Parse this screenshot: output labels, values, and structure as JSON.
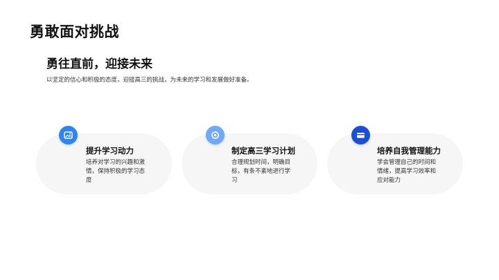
{
  "slide": {
    "title": "勇敢面对挑战",
    "subtitle": "勇往直前，迎接未来",
    "intro": "以坚定的信心和积极的态度，迎接高三的挑战，为未来的学习和发展做好准备。"
  },
  "cards": [
    {
      "icon": "image-icon",
      "icon_color": "#2f84f0",
      "heading": "提升学习动力",
      "text": "培养对学习的兴趣和激情，保持积极的学习态度"
    },
    {
      "icon": "target-icon",
      "icon_color": "#6ea8f7",
      "heading": "制定高三学习计划",
      "text": "合理规划时间，明确目标，有条不紊地进行学习"
    },
    {
      "icon": "card-icon",
      "icon_color": "#1b4fd8",
      "heading": "培养自我管理能力",
      "text": "学会管理自己的时间和情绪，提高学习效率和应对能力"
    }
  ]
}
